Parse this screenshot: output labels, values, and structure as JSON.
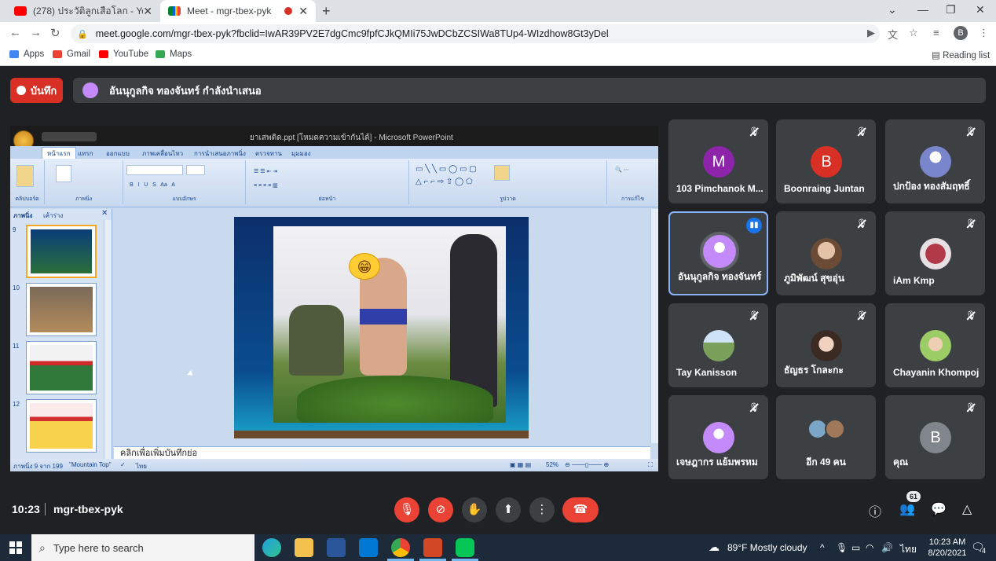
{
  "browser": {
    "tabs": [
      {
        "title": "(278) ประวัติลูกเสือโลก - YouTube",
        "active": false
      },
      {
        "title": "Meet - mgr-tbex-pyk",
        "active": true
      }
    ],
    "url": "meet.google.com/mgr-tbex-pyk?fbclid=IwAR39PV2E7dgCmc9fpfCJkQMIi75JwDCbZCSIWa8TUp4-WIzdhow8Gt3yDel",
    "profile_initial": "B",
    "bookmarks": [
      {
        "label": "Apps",
        "color": "#4285f4"
      },
      {
        "label": "Gmail",
        "color": "#ea4335"
      },
      {
        "label": "YouTube",
        "color": "#ff0000"
      },
      {
        "label": "Maps",
        "color": "#34a853"
      }
    ],
    "reading_list": "Reading list"
  },
  "meet": {
    "record_label": "บันทึก",
    "presenter_text": "อันนุกูลกิจ ทองจันทร์ กำลังนำเสนอ",
    "time": "10:23",
    "meeting_code": "mgr-tbex-pyk",
    "participant_count": "61",
    "participants": [
      {
        "name": "103 Pimchanok M...",
        "initial": "M",
        "color": "#8e24aa",
        "muted": true
      },
      {
        "name": "Boonraing Juntan",
        "initial": "B",
        "color": "#d93025",
        "muted": true
      },
      {
        "name": "ปกป้อง ทองสัมฤทธิ์",
        "initial": "",
        "color": "#7986cb",
        "muted": true
      },
      {
        "name": "อันนุกูลกิจ ทองจันทร์",
        "initial": "",
        "color": "#c58af9",
        "muted": false,
        "speaking": true
      },
      {
        "name": "ภูมิพัฒน์ สุขอุ่น",
        "initial": "",
        "color": "#6b4a36",
        "muted": true
      },
      {
        "name": "iAm Kmp",
        "initial": "",
        "color": "#b23a48",
        "muted": true
      },
      {
        "name": "Tay Kanisson",
        "initial": "",
        "color": "#7ba05b",
        "muted": true
      },
      {
        "name": "ธัญธร โกละกะ",
        "initial": "",
        "color": "#d8b4a0",
        "muted": true
      },
      {
        "name": "Chayanin Khompoj",
        "initial": "",
        "color": "#9ccc65",
        "muted": true
      },
      {
        "name": "เจษฎากร แย้มพรหม",
        "initial": "",
        "color": "#c58af9",
        "muted": true
      },
      {
        "name": "อีก 49 คน",
        "initial": "",
        "color": "#607d8b",
        "muted": false,
        "others": true
      },
      {
        "name": "คุณ",
        "initial": "B",
        "color": "#80868b",
        "muted": true
      }
    ]
  },
  "ppt": {
    "window_title": "ยาเสพติด.ppt [โหมดความเข้ากันได้] - Microsoft PowerPoint",
    "ribbon_tabs": [
      "หน้าแรก",
      "แทรก",
      "ออกแบบ",
      "ภาพเคลื่อนไหว",
      "การนำเสนอภาพนิ่ง",
      "ตรวจทาน",
      "มุมมอง"
    ],
    "ribbon_groups": [
      "คลิปบอร์ด",
      "ภาพนิ่ง",
      "แบบอักษร",
      "ย่อหน้า",
      "รูปวาด",
      "การแก้ไข"
    ],
    "pane_tabs": [
      "ภาพนิ่ง",
      "เค้าร่าง"
    ],
    "slide_numbers": [
      "9",
      "10",
      "11",
      "12"
    ],
    "notes_placeholder": "คลิกเพื่อเพิ่มบันทึกย่อ",
    "status_slide": "ภาพนิ่ง 9 จาก 199",
    "status_theme": "\"Mountain Top\"",
    "status_lang": "ไทย",
    "zoom": "52%"
  },
  "taskbar": {
    "search_placeholder": "Type here to search",
    "weather": "89°F  Mostly cloudy",
    "lang": "ไทย",
    "time": "10:23 AM",
    "date": "8/20/2021",
    "notifications": "4"
  }
}
